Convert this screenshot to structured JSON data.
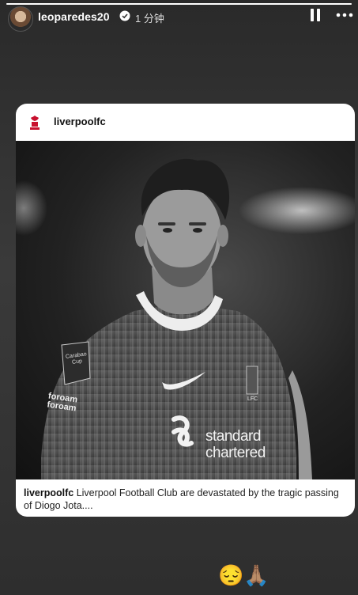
{
  "story": {
    "username": "leoparedes20",
    "time_ago": "1 分钟",
    "progress": 1.0
  },
  "card": {
    "account": "liverpoolfc",
    "caption_user": "liverpoolfc",
    "caption_text": " Liverpool Football Club are devastated by the tragic passing of Diogo Jota....",
    "photo": {
      "badge_text": "Carabao Cup",
      "sleeve_text": "foroam\nforoam",
      "sponsor_line1": "standard",
      "sponsor_line2": "chartered",
      "crest_text": "LFC"
    }
  },
  "reactions": [
    "😔",
    "🙏🏽"
  ],
  "colors": {
    "background": "#333333",
    "card": "#ffffff",
    "lfc_red": "#c8102e"
  }
}
